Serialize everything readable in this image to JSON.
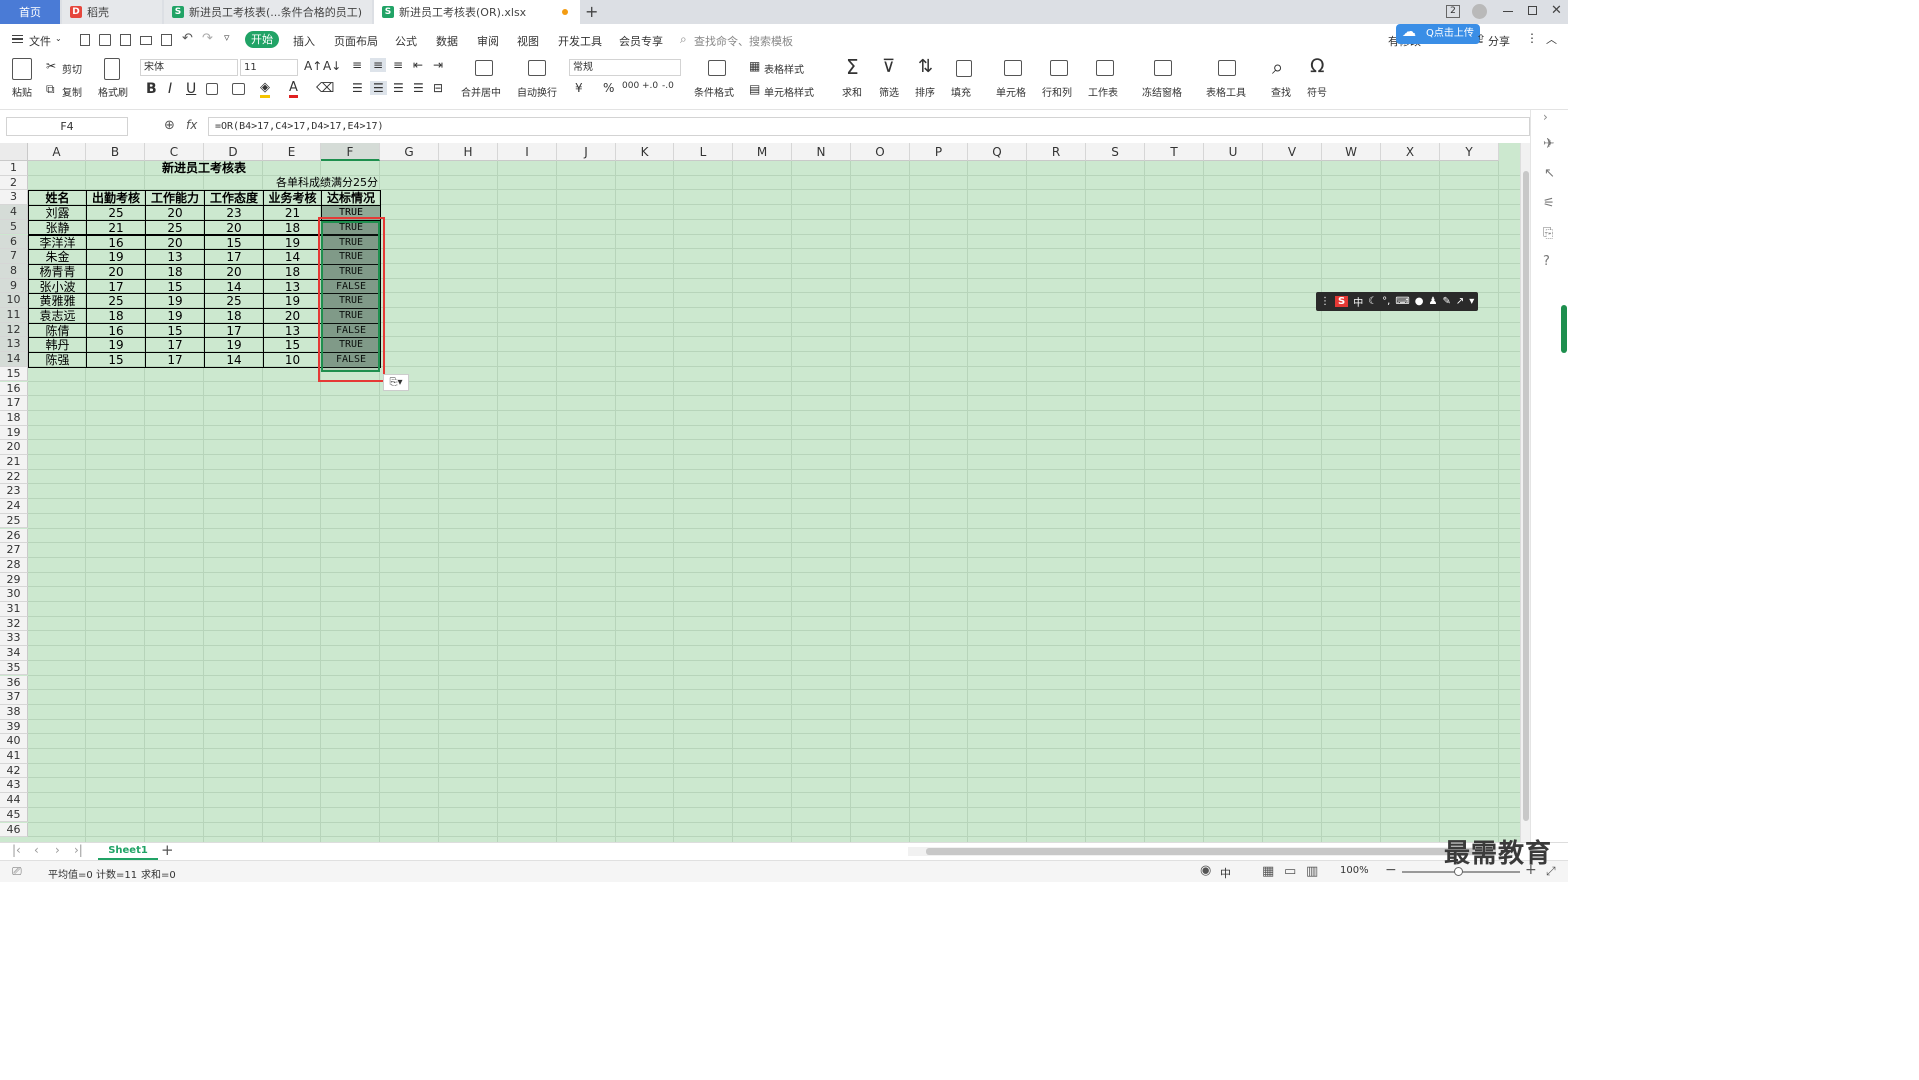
{
  "tabs": [
    {
      "label": "首页"
    },
    {
      "label": "稻壳"
    },
    {
      "label": "新进员工考核表(...条件合格的员工)"
    },
    {
      "label": "新进员工考核表(OR).xlsx"
    }
  ],
  "menu": {
    "file": "文件",
    "start": "开始",
    "items": [
      "插入",
      "页面布局",
      "公式",
      "数据",
      "审阅",
      "视图",
      "开发工具",
      "会员专享"
    ],
    "search_placeholder": "查找命令、搜索模板",
    "unsync": "有修改",
    "share": "分享",
    "cloud": "Q点击上传"
  },
  "ribbon": {
    "paste": "粘贴",
    "cut": "剪切",
    "copy": "复制",
    "format_painter": "格式刷",
    "font_name": "宋体",
    "font_size": "11",
    "bold": "B",
    "italic": "I",
    "underline": "U",
    "merge_center": "合并居中",
    "wrap": "自动换行",
    "number_format": "常规",
    "cond_format": "条件格式",
    "table_style": "表格样式",
    "cell_style": "单元格样式",
    "sum": "求和",
    "filter": "筛选",
    "sort": "排序",
    "fill": "填充",
    "cell": "单元格",
    "rowcol": "行和列",
    "worksheet": "工作表",
    "freeze": "冻结窗格",
    "table_tools": "表格工具",
    "find": "查找",
    "symbol": "符号",
    "currency": "¥",
    "percent": "%",
    "thousands": "000",
    "inc_dec": "+.0",
    "dec_dec": "-.0"
  },
  "formula": {
    "namebox": "F4",
    "fx": "fx",
    "text": "=OR(B4>17,C4>17,D4>17,E4>17)"
  },
  "columns": [
    "A",
    "B",
    "C",
    "D",
    "E",
    "F",
    "G",
    "H",
    "I",
    "J",
    "K",
    "L",
    "M",
    "N",
    "O",
    "P",
    "Q",
    "R",
    "S",
    "T",
    "U",
    "V",
    "W",
    "X",
    "Y"
  ],
  "rows": [
    "1",
    "2",
    "3",
    "4",
    "5",
    "6",
    "7",
    "8",
    "9",
    "10",
    "11",
    "12",
    "13",
    "14",
    "15",
    "16",
    "17",
    "18",
    "19",
    "20",
    "21",
    "22",
    "23",
    "24",
    "25",
    "26",
    "27",
    "28",
    "29",
    "30",
    "31",
    "32",
    "33",
    "34",
    "35",
    "36",
    "37",
    "38",
    "39",
    "40",
    "41",
    "42",
    "43",
    "44",
    "45",
    "46"
  ],
  "sheet_title": "新进员工考核表",
  "note": "各单科成绩满分25分",
  "headers": [
    "姓名",
    "出勤考核",
    "工作能力",
    "工作态度",
    "业务考核",
    "达标情况"
  ],
  "table": [
    [
      "刘露",
      "25",
      "20",
      "23",
      "21",
      "TRUE"
    ],
    [
      "张静",
      "21",
      "25",
      "20",
      "18",
      "TRUE"
    ],
    [
      "李洋洋",
      "16",
      "20",
      "15",
      "19",
      "TRUE"
    ],
    [
      "朱金",
      "19",
      "13",
      "17",
      "14",
      "TRUE"
    ],
    [
      "杨青青",
      "20",
      "18",
      "20",
      "18",
      "TRUE"
    ],
    [
      "张小波",
      "17",
      "15",
      "14",
      "13",
      "FALSE"
    ],
    [
      "黄雅雅",
      "25",
      "19",
      "25",
      "19",
      "TRUE"
    ],
    [
      "袁志远",
      "18",
      "19",
      "18",
      "20",
      "TRUE"
    ],
    [
      "陈倩",
      "16",
      "15",
      "17",
      "13",
      "FALSE"
    ],
    [
      "韩丹",
      "19",
      "17",
      "19",
      "15",
      "TRUE"
    ],
    [
      "陈强",
      "15",
      "17",
      "14",
      "10",
      "FALSE"
    ]
  ],
  "sheet_tab": "Sheet1",
  "status": {
    "avg": "平均值=0",
    "count": "计数=11",
    "sum": "求和=0",
    "zoom": "100%",
    "ime": "中"
  },
  "ime_bar": {
    "logo": "S",
    "lang": "中"
  },
  "watermark": "最需教育",
  "badge": "2"
}
